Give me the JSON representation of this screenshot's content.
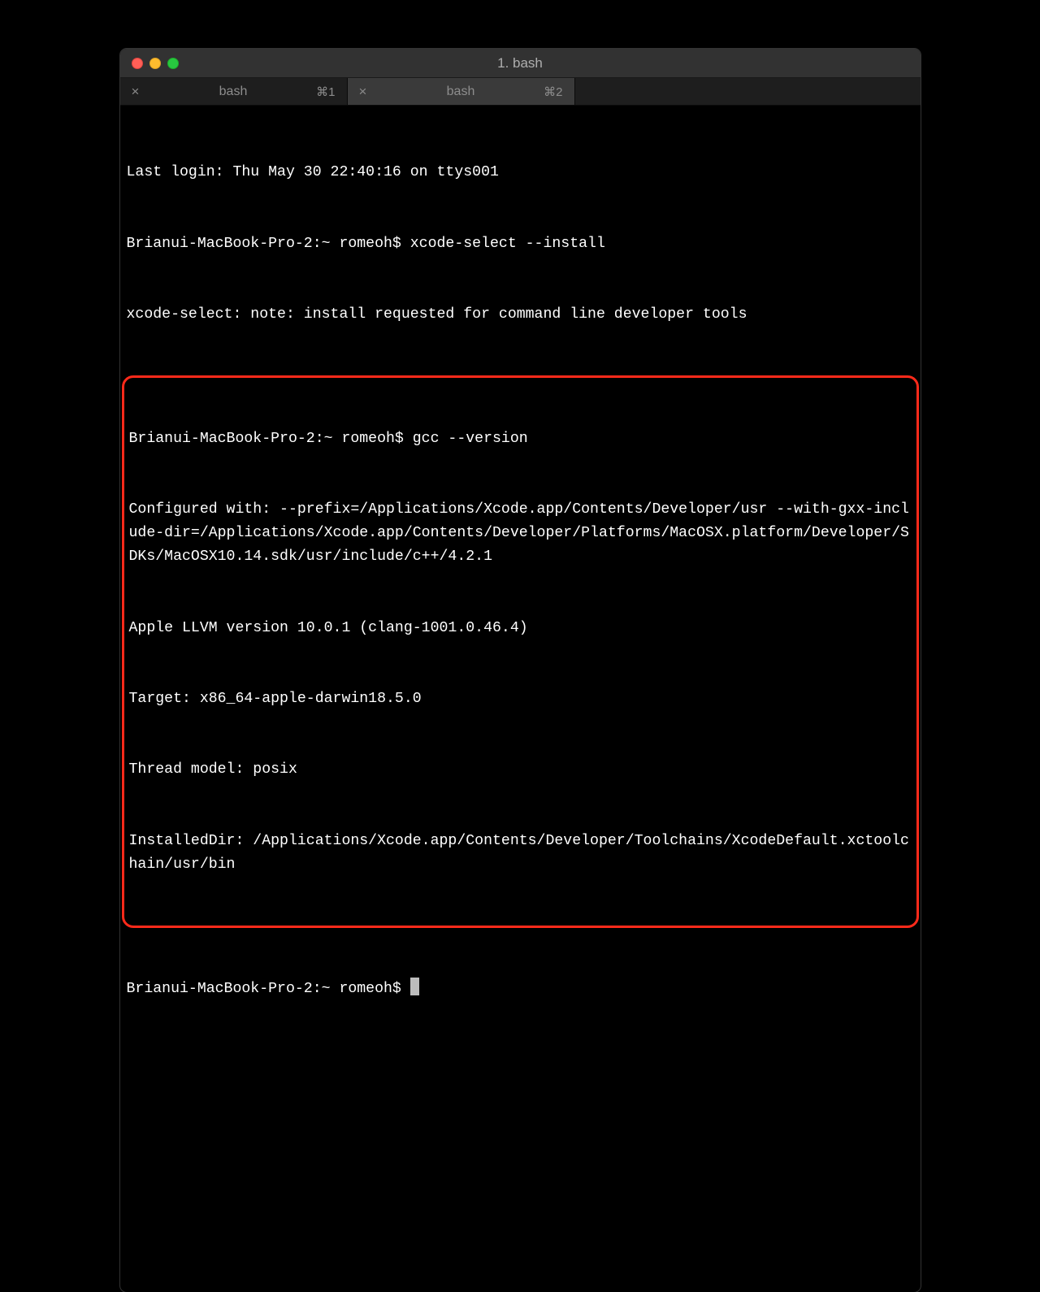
{
  "window": {
    "title": "1. bash"
  },
  "tabs": [
    {
      "label": "bash",
      "shortcut": "⌘1",
      "active": false
    },
    {
      "label": "bash",
      "shortcut": "⌘2",
      "active": true
    }
  ],
  "terminal": {
    "lines_pre": [
      "Last login: Thu May 30 22:40:16 on ttys001",
      "Brianui-MacBook-Pro-2:~ romeoh$ xcode-select --install",
      "xcode-select: note: install requested for command line developer tools"
    ],
    "highlight_lines": [
      "Brianui-MacBook-Pro-2:~ romeoh$ gcc --version",
      "Configured with: --prefix=/Applications/Xcode.app/Contents/Developer/usr --with-gxx-include-dir=/Applications/Xcode.app/Contents/Developer/Platforms/MacOSX.platform/Developer/SDKs/MacOSX10.14.sdk/usr/include/c++/4.2.1",
      "Apple LLVM version 10.0.1 (clang-1001.0.46.4)",
      "Target: x86_64-apple-darwin18.5.0",
      "Thread model: posix",
      "InstalledDir: /Applications/Xcode.app/Contents/Developer/Toolchains/XcodeDefault.xctoolchain/usr/bin"
    ],
    "prompt_after": "Brianui-MacBook-Pro-2:~ romeoh$ "
  }
}
